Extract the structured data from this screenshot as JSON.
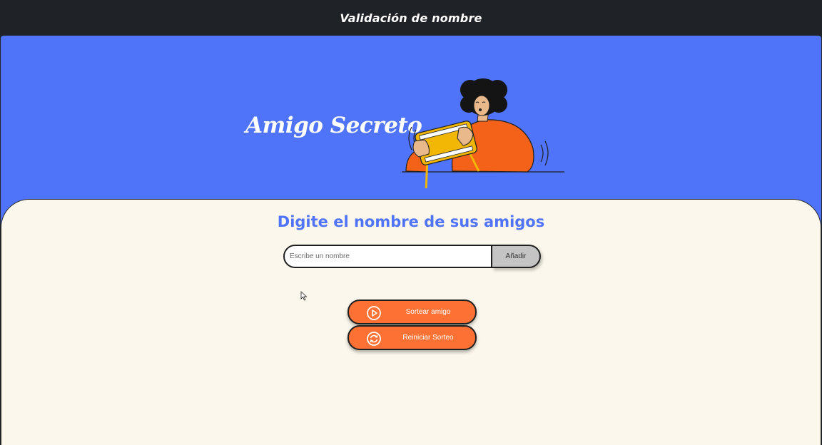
{
  "window": {
    "title": "Validación de nombre"
  },
  "hero": {
    "title": "Amigo Secreto",
    "illustration": "person-playing-handheld-console"
  },
  "main": {
    "heading": "Digite el nombre de sus amigos",
    "input": {
      "placeholder": "Escribe un nombre",
      "value": ""
    },
    "add_button": "Añadir",
    "draw_button": {
      "label": "Sortear amigo",
      "icon": "play-circle-icon"
    },
    "reset_button": {
      "label": "Reiniciar Sorteo",
      "icon": "refresh-circle-icon"
    }
  },
  "colors": {
    "titlebar": "#1f2227",
    "hero_bg": "#4f74f9",
    "panel_bg": "#fbf7ec",
    "accent_blue": "#4f74f9",
    "button_orange": "#fd7234",
    "add_button_bg": "#c4c4c4"
  }
}
